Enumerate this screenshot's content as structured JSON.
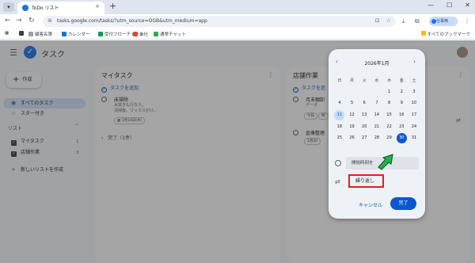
{
  "browser": {
    "tab_title": "ToDo リスト",
    "tab_close": "×",
    "new_tab": "+",
    "window_controls": [
      "—",
      "☐",
      "✕"
    ],
    "url": "tasks.google.com/tasks/?utm_source=OGB&utm_medium=app",
    "profile_label": "仕事用",
    "nav": {
      "back": "←",
      "forward": "→",
      "reload": "↻",
      "star": "☆"
    }
  },
  "bookmarks": {
    "items": [
      "顧客名簿",
      "カレンダー",
      "受付フローチャート",
      "会社",
      "通常チャット"
    ],
    "right": "すべてのブックマーク"
  },
  "app": {
    "title": "タスク",
    "logo_glyph": "✓",
    "create_label": "作成",
    "sidebar": {
      "all_tasks": "すべてのタスク",
      "starred": "スター付き",
      "lists_heading": "リスト",
      "lists": [
        {
          "name": "マイタスク",
          "count": "1"
        },
        {
          "name": "店舗作業",
          "count": "3"
        }
      ],
      "new_list": "新しいリストを作成"
    },
    "columns": [
      {
        "title": "マイタスク",
        "add_task": "タスクを追加",
        "tasks": [
          {
            "title": "床掃除",
            "note1": "水拭きも行なう。",
            "note2": "清掃後、ワックスがけ。",
            "date": "1月14日(水)"
          }
        ],
        "done": "完了（1件）"
      },
      {
        "title": "店舗作業",
        "add_task": "タスクを追",
        "tasks": [
          {
            "title": "月末棚卸",
            "note1": "データ",
            "chips": [
              "今日",
              "明"
            ]
          },
          {
            "title": "倉庫整理",
            "date": "1月30"
          }
        ]
      }
    ]
  },
  "datepicker": {
    "month_label": "2026年1月",
    "prev": "‹",
    "next": "›",
    "weekdays": [
      "日",
      "月",
      "火",
      "水",
      "木",
      "金",
      "土"
    ],
    "weeks": [
      [
        "",
        "",
        "",
        "",
        "1",
        "2",
        "3"
      ],
      [
        "4",
        "5",
        "6",
        "7",
        "8",
        "9",
        "10"
      ],
      [
        "11",
        "12",
        "13",
        "14",
        "15",
        "16",
        "17"
      ],
      [
        "18",
        "19",
        "20",
        "21",
        "22",
        "23",
        "24"
      ],
      [
        "25",
        "26",
        "27",
        "28",
        "29",
        "30",
        "31"
      ]
    ],
    "selected_day": "30",
    "today_day": "11",
    "time_placeholder": "開始時刻を",
    "repeat_label": "繰り返し",
    "cancel_label": "キャンセル",
    "done_label": "完了"
  },
  "colors": {
    "accent": "#0b57d0",
    "highlight_box": "#e0211c",
    "arrow": "#22b14c"
  }
}
